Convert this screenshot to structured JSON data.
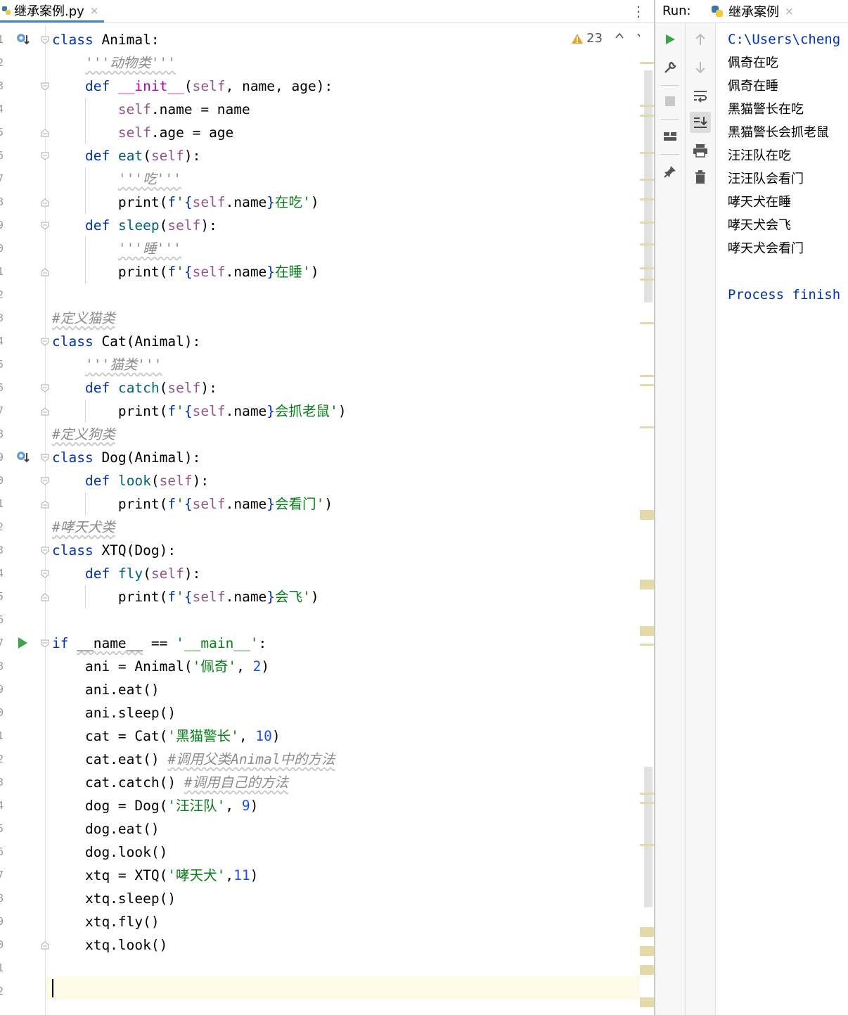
{
  "editor": {
    "tab_label": "继承案例.py",
    "tab_close": "×",
    "menu_glyph": "⋮",
    "warning_count": "23"
  },
  "line_numbers": [
    "1",
    "2",
    "3",
    "4",
    "5",
    "6",
    "7",
    "8",
    "9",
    "0",
    "1",
    "2",
    "3",
    "4",
    "5",
    "6",
    "7",
    "8",
    "9",
    "0",
    "1",
    "2",
    "3",
    "4",
    "5",
    "6",
    "7",
    "8",
    "9",
    "0",
    "1",
    "2",
    "3",
    "4",
    "5",
    "6",
    "7",
    "8",
    "9",
    "0",
    "1",
    "2"
  ],
  "code_lines": [
    "class Animal:",
    "    '''动物类'''",
    "    def __init__(self, name, age):",
    "        self.name = name",
    "        self.age = age",
    "    def eat(self):",
    "        '''吃'''",
    "        print(f'{self.name}在吃')",
    "    def sleep(self):",
    "        '''睡'''",
    "        print(f'{self.name}在睡')",
    "",
    "#定义猫类",
    "class Cat(Animal):",
    "    '''猫类'''",
    "    def catch(self):",
    "        print(f'{self.name}会抓老鼠')",
    "#定义狗类",
    "class Dog(Animal):",
    "    def look(self):",
    "        print(f'{self.name}会看门')",
    "#哮天犬类",
    "class XTQ(Dog):",
    "    def fly(self):",
    "        print(f'{self.name}会飞')",
    "",
    "if __name__ == '__main__':",
    "    ani = Animal('佩奇', 2)",
    "    ani.eat()",
    "    ani.sleep()",
    "    cat = Cat('黑猫警长', 10)",
    "    cat.eat() #调用父类Animal中的方法",
    "    cat.catch() #调用自己的方法",
    "    dog = Dog('汪汪队', 9)",
    "    dog.eat()",
    "    dog.look()",
    "    xtq = XTQ('哮天犬',11)",
    "    xtq.sleep()",
    "    xtq.fly()",
    "    xtq.look()",
    "",
    ""
  ],
  "run": {
    "title": "Run:",
    "tab_label": "继承案例",
    "tab_close": "×",
    "console_lines": [
      "C:\\Users\\cheng",
      "佩奇在吃",
      "佩奇在睡",
      "黑猫警长在吃",
      "黑猫警长会抓老鼠",
      "汪汪队在吃",
      "汪汪队会看门",
      "哮天犬在睡",
      "哮天犬会飞",
      "哮天犬会看门",
      "",
      "Process finish"
    ]
  },
  "colors": {
    "keyword": "#0033b3",
    "self": "#94558d",
    "string": "#067d17",
    "number": "#1750eb",
    "comment": "#8c8c8c",
    "warning": "#e2a32b",
    "run_green": "#3aa34b"
  },
  "icons": [
    "python-file-icon",
    "breakpoint-override-icon",
    "run-gutter-icon",
    "warning-icon",
    "rerun-icon",
    "wrench-icon",
    "stop-icon",
    "layout-icon",
    "pin-icon",
    "up-arrow-icon",
    "down-arrow-icon",
    "soft-wrap-icon",
    "scroll-to-end-icon",
    "print-icon",
    "trash-icon"
  ]
}
